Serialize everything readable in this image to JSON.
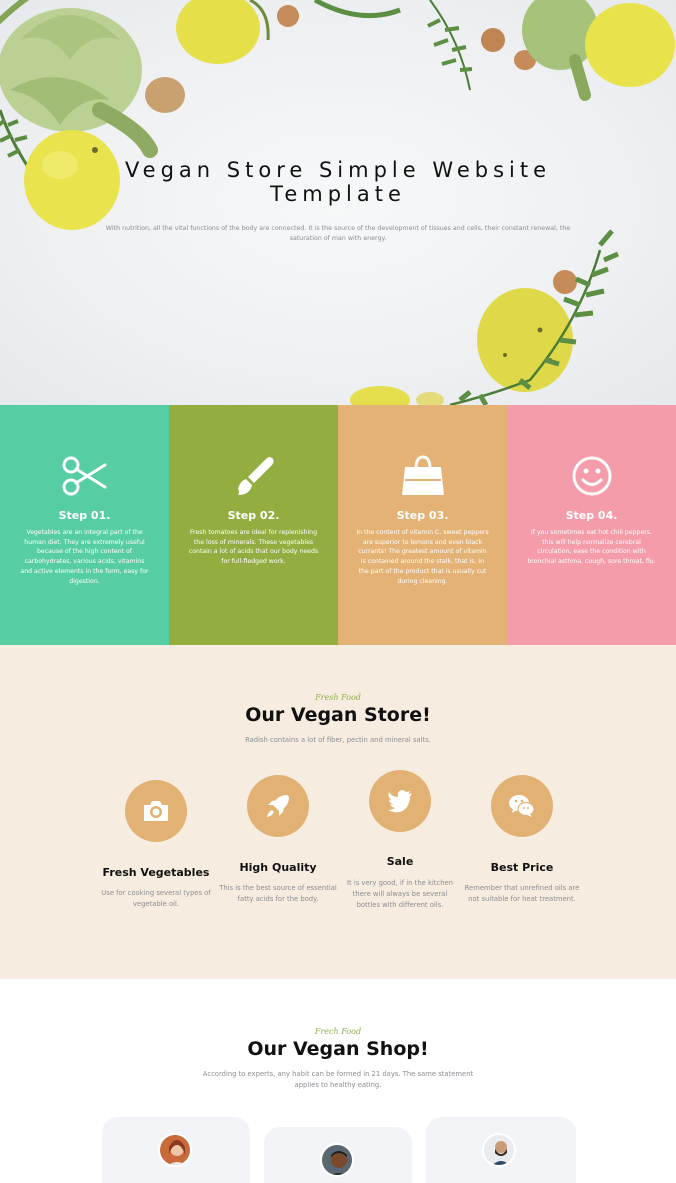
{
  "hero": {
    "title": "Vegan Store Simple Website Template",
    "text": "With nutrition, all the vital functions of the body are connected. It is the source of the development of tissues and cells, their constant renewal, the saturation of man with energy."
  },
  "steps": [
    {
      "title": "Step 01.",
      "icon": "scissors-icon",
      "color": "#57cda3",
      "text": "Vegetables are an integral part of the human diet. They are extremely useful because of the high content of carbohydrates, various acids, vitamins and active elements in the form, easy for digestion."
    },
    {
      "title": "Step 02.",
      "icon": "brush-icon",
      "color": "#93ad40",
      "text": "Fresh tomatoes are ideal for replenishing the loss of minerals. These vegetables contain a lot of acids that our body needs for full-fledged work."
    },
    {
      "title": "Step 03.",
      "icon": "shopping-bag-icon",
      "color": "#e4b274",
      "text": "In the content of vitamin C, sweet peppers are superior to lemons and even black currants! The greatest amount of vitamin is contained around the stalk, that is, in the part of the product that is usually cut during cleaning."
    },
    {
      "title": "Step 04.",
      "icon": "smiley-icon",
      "color": "#f59caa",
      "text": "If you sometimes eat hot chili peppers, this will help normalize cerebral circulation, ease the condition with bronchial asthma, cough, sore throat, flu."
    }
  ],
  "store": {
    "kicker": "Fresh Food",
    "title": "Our Vegan Store!",
    "subtitle": "Radish contains a lot of fiber, pectin and mineral salts.",
    "features": [
      {
        "icon": "camera-icon",
        "title": "Fresh Vegetables",
        "text": "Use for cooking several types of vegetable oil."
      },
      {
        "icon": "rocket-icon",
        "title": "High Quality",
        "text": "This is the best source of essential fatty acids for the body."
      },
      {
        "icon": "twitter-icon",
        "title": "Sale",
        "text": "It is very good, if in the kitchen there will always be several bottles with different oils."
      },
      {
        "icon": "wechat-icon",
        "title": "Best Price",
        "text": "Remember that unrefined oils are not suitable for heat treatment."
      }
    ]
  },
  "shop": {
    "kicker": "Frech Food",
    "title": "Our Vegan Shop!",
    "subtitle": "According to experts, any habit can be formed in 21 days. The same statement applies to healthy eating."
  },
  "colors": {
    "accent": "#e2b274",
    "kicker": "#8fb04a",
    "store_bg": "#f7ece0"
  }
}
